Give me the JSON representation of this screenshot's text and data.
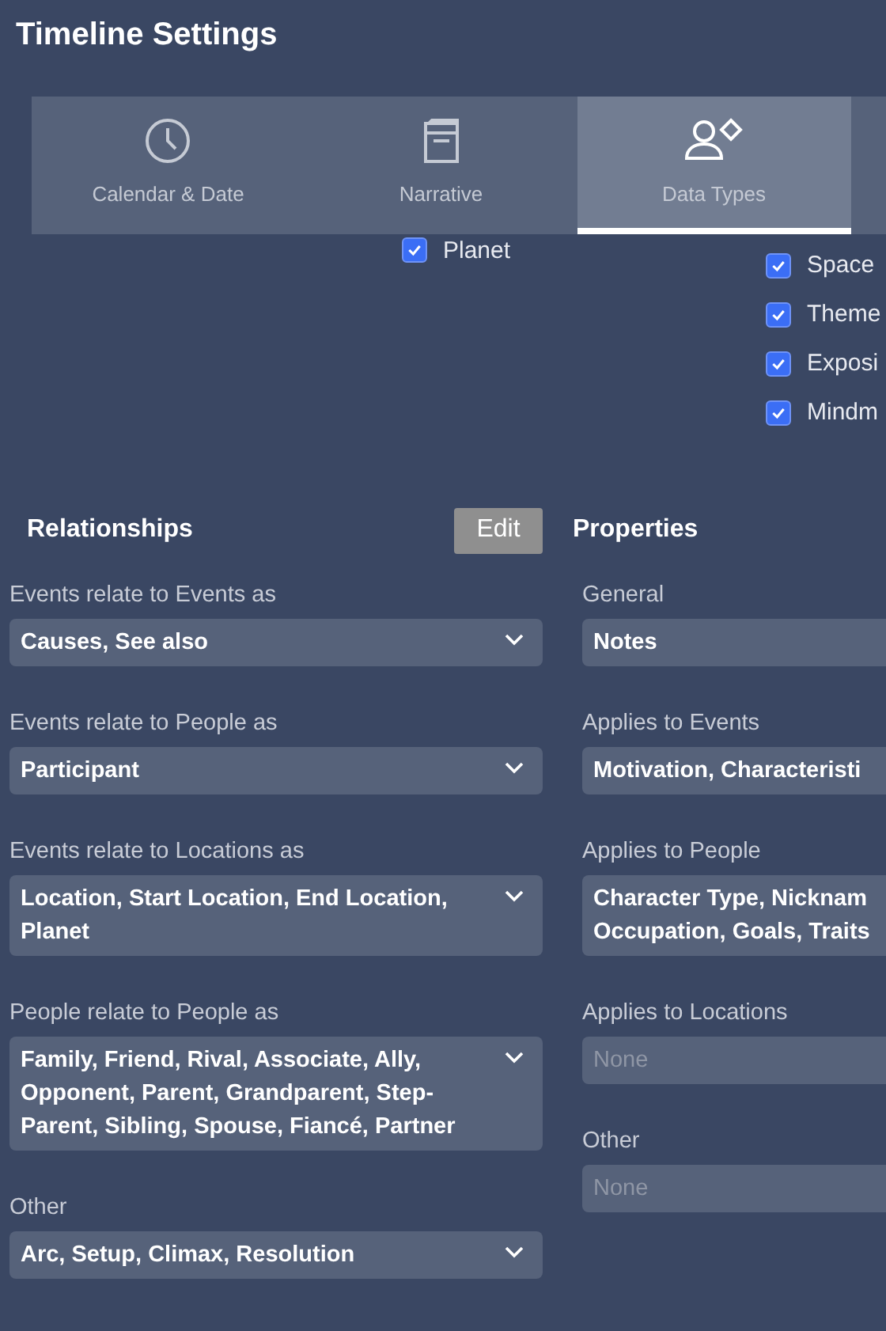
{
  "window": {
    "title": "Timeline Settings"
  },
  "tabs": [
    {
      "label": "Calendar & Date",
      "selected": false
    },
    {
      "label": "Narrative",
      "selected": false
    },
    {
      "label": "Data Types",
      "selected": true
    }
  ],
  "data_types": {
    "column_1": [
      {
        "label": "Planet",
        "checked": true
      }
    ],
    "column_2": [
      {
        "label": "Space",
        "checked": true
      },
      {
        "label": "Theme",
        "checked": true
      },
      {
        "label": "Exposi",
        "checked": true
      },
      {
        "label": "Mindm",
        "checked": true
      }
    ]
  },
  "relationships": {
    "title": "Relationships",
    "edit_button": "Edit",
    "fields": [
      {
        "label": "Events relate to Events as",
        "value": "Causes, See also",
        "disabled": false
      },
      {
        "label": "Events relate to People as",
        "value": "Participant",
        "disabled": false
      },
      {
        "label": "Events relate to Locations as",
        "value": "Location, Start Location, End Location, Planet",
        "disabled": false
      },
      {
        "label": "People relate to People as",
        "value": "Family, Friend, Rival, Associate, Ally, Opponent, Parent, Grandparent, Step-Parent, Sibling, Spouse, Fiancé, Partner",
        "disabled": false
      },
      {
        "label": "Other",
        "value": "Arc, Setup, Climax, Resolution",
        "disabled": false
      }
    ]
  },
  "properties": {
    "title": "Properties",
    "fields": [
      {
        "label": "General",
        "value": "Notes",
        "disabled": false
      },
      {
        "label": "Applies to Events",
        "value": "Motivation, Characteristi",
        "disabled": false
      },
      {
        "label": "Applies to People",
        "value": "Character Type, Nicknam\nOccupation, Goals, Traits",
        "disabled": false
      },
      {
        "label": "Applies to Locations",
        "value": "None",
        "disabled": true
      },
      {
        "label": "Other",
        "value": "None",
        "disabled": true
      }
    ]
  }
}
